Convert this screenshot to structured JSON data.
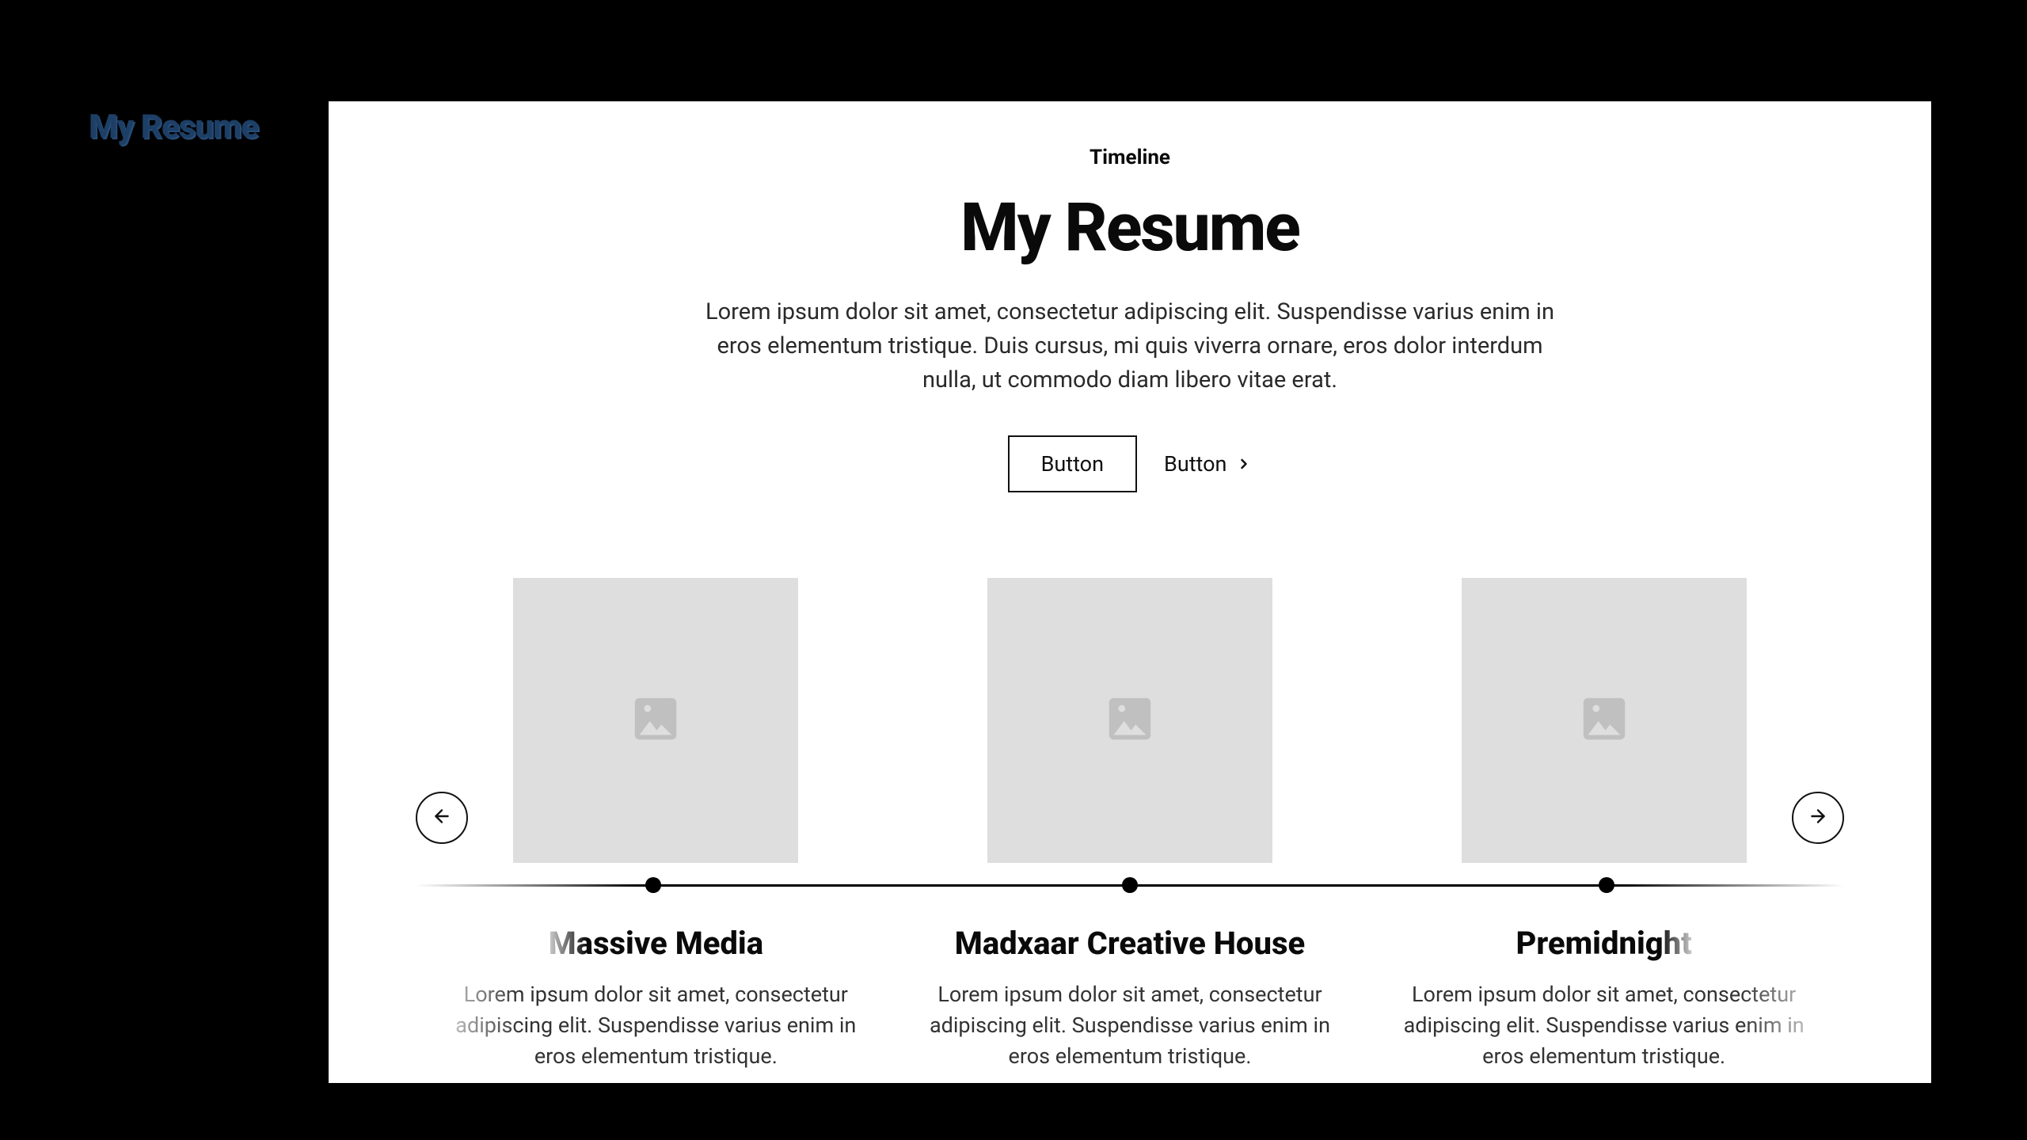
{
  "thumb_label": "My Resume",
  "header": {
    "eyebrow": "Timeline",
    "title": "My Resume",
    "lead": "Lorem ipsum dolor sit amet, consectetur adipiscing elit. Suspendisse varius enim in eros elementum tristique. Duis cursus, mi quis viverra ornare, eros dolor interdum nulla, ut commodo diam libero vitae erat."
  },
  "cta": {
    "primary_label": "Button",
    "secondary_label": "Button"
  },
  "timeline": {
    "items": [
      {
        "title": "Massive Media",
        "desc": "Lorem ipsum dolor sit amet, consectetur adipiscing elit. Suspendisse varius enim in eros elementum tristique."
      },
      {
        "title": "Madxaar Creative House",
        "desc": "Lorem ipsum dolor sit amet, consectetur adipiscing elit. Suspendisse varius enim in eros elementum tristique."
      },
      {
        "title": "Premidnight",
        "desc": "Lorem ipsum dolor sit amet, consectetur adipiscing elit. Suspendisse varius enim in eros elementum tristique."
      }
    ]
  }
}
